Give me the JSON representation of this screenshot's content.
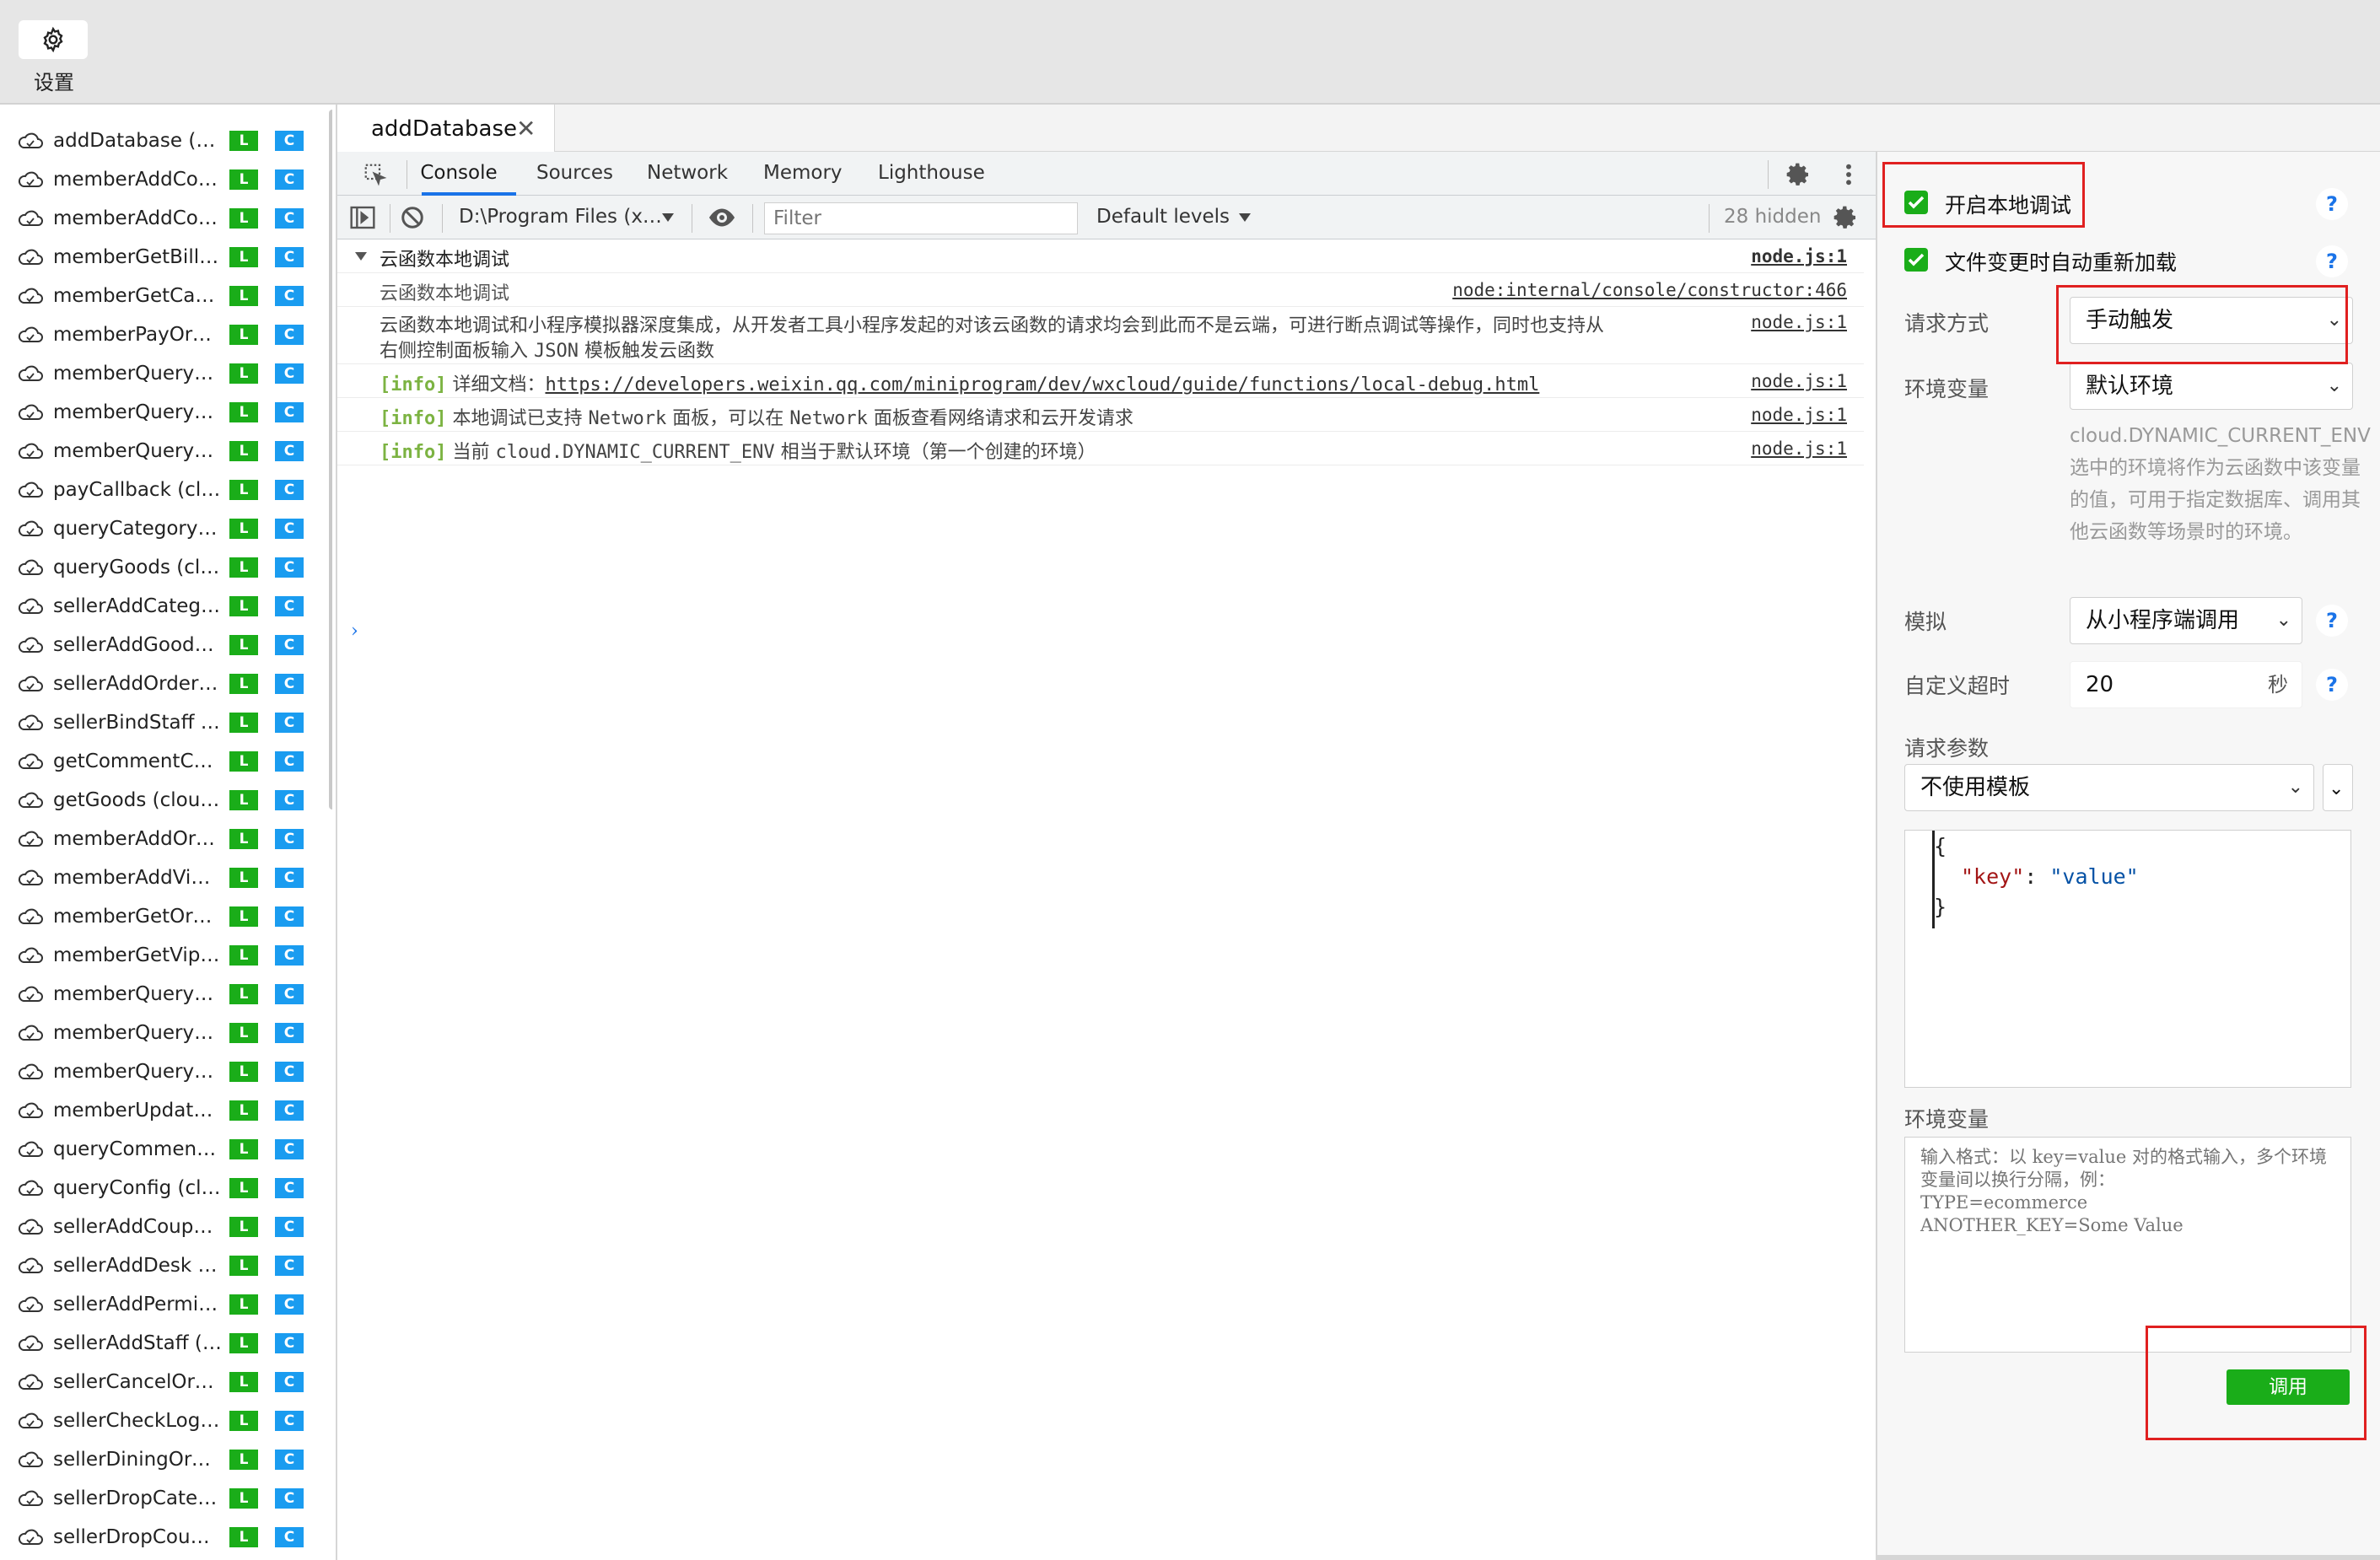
{
  "topbar": {
    "settings_label": "设置"
  },
  "tab": {
    "label": "addDatabase",
    "close": "✕"
  },
  "sidebar": {
    "badge_l": "L",
    "badge_c": "C",
    "items": [
      "addDatabase (cl…",
      "memberAddCo…",
      "memberAddCou…",
      "memberGetBilli…",
      "memberGetCart…",
      "memberPayOrd…",
      "memberQueryC…",
      "memberQueryC…",
      "memberQueryO…",
      "payCallback (cl…",
      "queryCategory (…",
      "queryGoods (cl…",
      "sellerAddCateg…",
      "sellerAddGoods…",
      "sellerAddOrder …",
      "sellerBindStaff (…",
      "getCommentCo…",
      "getGoods (clou…",
      "memberAddOrd…",
      "memberAddVip …",
      "memberGetOrd…",
      "memberGetVip (…",
      "memberQueryC…",
      "memberQueryC…",
      "memberQueryO…",
      "memberUpdate…",
      "queryComment …",
      "queryConfig (clo…",
      "sellerAddCoupo…",
      "sellerAddDesk (…",
      "sellerAddPermis…",
      "sellerAddStaff (c…",
      "sellerCancelOrd…",
      "sellerCheckLogi…",
      "sellerDiningOrd…",
      "sellerDropCateg…",
      "sellerDropCoup…"
    ]
  },
  "devtools": {
    "tabs": [
      "Console",
      "Sources",
      "Network",
      "Memory",
      "Lighthouse"
    ],
    "context": "D:\\Program Files (x…",
    "filter_placeholder": "Filter",
    "levels": "Default levels",
    "hidden": "28 hidden"
  },
  "console": {
    "group_title": "云函数本地调试",
    "group_src": "node.js:1",
    "rows": [
      {
        "text": "云函数本地调试",
        "src": "node:internal/console/constructor:466"
      },
      {
        "text1": "云函数本地调试和小程序模拟器深度集成，从开发者工具小程序发起的对该云函数的请求均会到此而不是云端，可进行断点调试等操作，同时也支持从",
        "text2a": "右侧控制面板输入 ",
        "text2b": "JSON",
        "text2c": " 模板触发云函数",
        "src": "node.js:1"
      },
      {
        "tag": "[info]",
        "text": "详细文档：",
        "link": "https://developers.weixin.qq.com/miniprogram/dev/wxcloud/guide/functions/local-debug.html",
        "src": "node.js:1"
      },
      {
        "tag": "[info]",
        "t1": "本地调试已支持 ",
        "t2": "Network",
        "t3": " 面板，可以在 ",
        "t4": "Network",
        "t5": " 面板查看网络请求和云开发请求",
        "src": "node.js:1"
      },
      {
        "tag": "[info]",
        "t1": "当前 ",
        "t2": "cloud.DYNAMIC_CURRENT_ENV",
        "t3": " 相当于默认环境（第一个创建的环境）",
        "src": "node.js:1"
      }
    ],
    "prompt": "›"
  },
  "panel": {
    "local_debug": "开启本地调试",
    "auto_reload": "文件变更时自动重新加载",
    "help": "?",
    "request_method_label": "请求方式",
    "request_method_value": "手动触发",
    "env_label": "环境变量",
    "env_value": "默认环境",
    "env_hint": "cloud.DYNAMIC_CURRENT_ENV 选中的环境将作为云函数中该变量的值，可用于指定数据库、调用其他云函数等场景时的环境。",
    "simulate_label": "模拟",
    "simulate_value": "从小程序端调用",
    "timeout_label": "自定义超时",
    "timeout_value": "20",
    "timeout_unit": "秒",
    "params_label": "请求参数",
    "template_value": "不使用模板",
    "code": {
      "open": "{",
      "key": "\"key\"",
      "colon": ": ",
      "value": "\"value\"",
      "close": "}"
    },
    "env_vars_label": "环境变量",
    "env_vars_placeholder": "输入格式：以 key=value 对的格式输入，多个环境变量间以换行分隔，例：\nTYPE=ecommerce\nANOTHER_KEY=Some Value",
    "invoke": "调用"
  },
  "colors": {
    "green": "#1aad19",
    "blue": "#1a9cf0",
    "red": "#e02020",
    "accent": "#1a73e8"
  }
}
